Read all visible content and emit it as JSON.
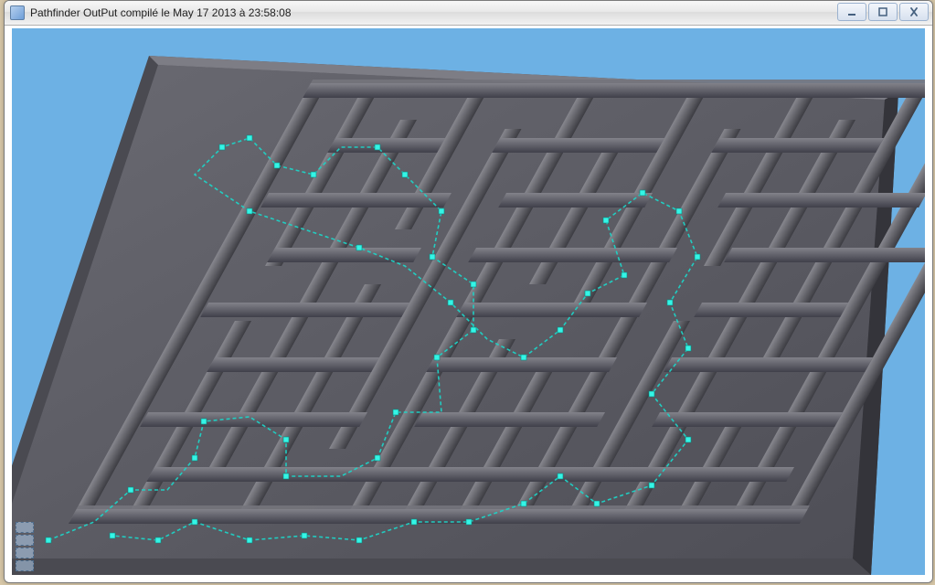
{
  "window": {
    "title": "Pathfinder OutPut compilé le May 17 2013 à 23:58:08"
  },
  "controls": {
    "minimize": "minimize",
    "maximize": "maximize",
    "close": "close"
  },
  "viewport": {
    "sky_color": "#6db1e4",
    "maze_top_color": "#5b5b62",
    "maze_wall_light": "#8a8a90",
    "maze_wall_dark": "#3a3a40",
    "path_color": "#2ee7d8",
    "node_color": "#34f5e6"
  }
}
